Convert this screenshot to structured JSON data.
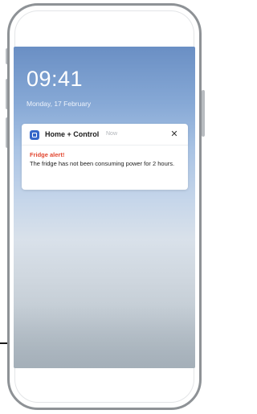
{
  "lockscreen": {
    "time": "09:41",
    "date": "Monday, 17 February"
  },
  "notification": {
    "app_name": "Home + Control",
    "timestamp": "Now",
    "close_icon": "close-icon",
    "title": "Fridge alert!",
    "body": "The fridge has not been consuming power for 2 hours."
  },
  "colors": {
    "app_icon": "#3566c9",
    "alert_title": "#e2462f"
  }
}
